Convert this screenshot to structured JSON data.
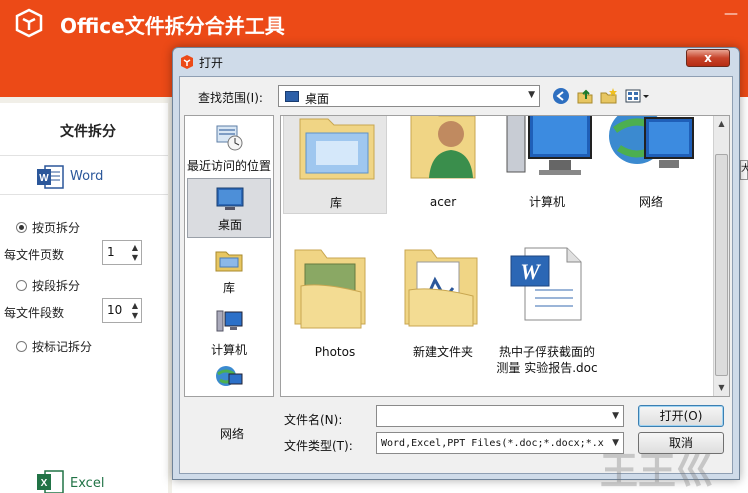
{
  "app": {
    "title": "Office文件拆分合并工具",
    "minimize": "—",
    "brand_color": "#ec4a17"
  },
  "left_panel": {
    "section_title": "文件拆分",
    "word_label": "Word",
    "excel_label": "Excel",
    "opt_by_page": "按页拆分",
    "pages_per_file_label": "每文件页数",
    "pages_per_file_value": "1",
    "opt_by_section": "按段拆分",
    "sections_per_file_label": "每文件段数",
    "sections_per_file_value": "10",
    "opt_by_bookmark": "按标记拆分",
    "selected_option": "按页拆分"
  },
  "right_edge_text": "大",
  "dialog": {
    "title": "打开",
    "close": "x",
    "look_in_label": "查找范围(I):",
    "look_in_value": "桌面",
    "toolbar_icons": [
      "back-icon",
      "up-folder-icon",
      "new-folder-icon",
      "view-menu-icon"
    ],
    "places": [
      {
        "label": "最近访问的位置",
        "icon": "recent-places-icon"
      },
      {
        "label": "桌面",
        "icon": "desktop-icon",
        "selected": true
      },
      {
        "label": "库",
        "icon": "libraries-icon"
      },
      {
        "label": "计算机",
        "icon": "computer-icon"
      },
      {
        "label": "网络",
        "icon": "network-icon"
      }
    ],
    "files": [
      {
        "label": "库",
        "icon": "libraries-folder-icon",
        "selected": true
      },
      {
        "label": "acer",
        "icon": "user-folder-icon"
      },
      {
        "label": "计算机",
        "icon": "computer-icon"
      },
      {
        "label": "网络",
        "icon": "network-icon"
      },
      {
        "label": "Photos",
        "icon": "folder-icon"
      },
      {
        "label": "新建文件夹",
        "icon": "folder-icon"
      },
      {
        "label": "热中子俘获截面的\n测量 实验报告.doc",
        "icon": "word-doc-icon"
      }
    ],
    "filename_label": "文件名(N):",
    "filename_value": "",
    "filetype_label": "文件类型(T):",
    "filetype_value": "Word,Excel,PPT Files(*.doc;*.docx;*.x",
    "open_button": "打开(O)",
    "cancel_button": "取消"
  },
  "watermark": "王王巛"
}
